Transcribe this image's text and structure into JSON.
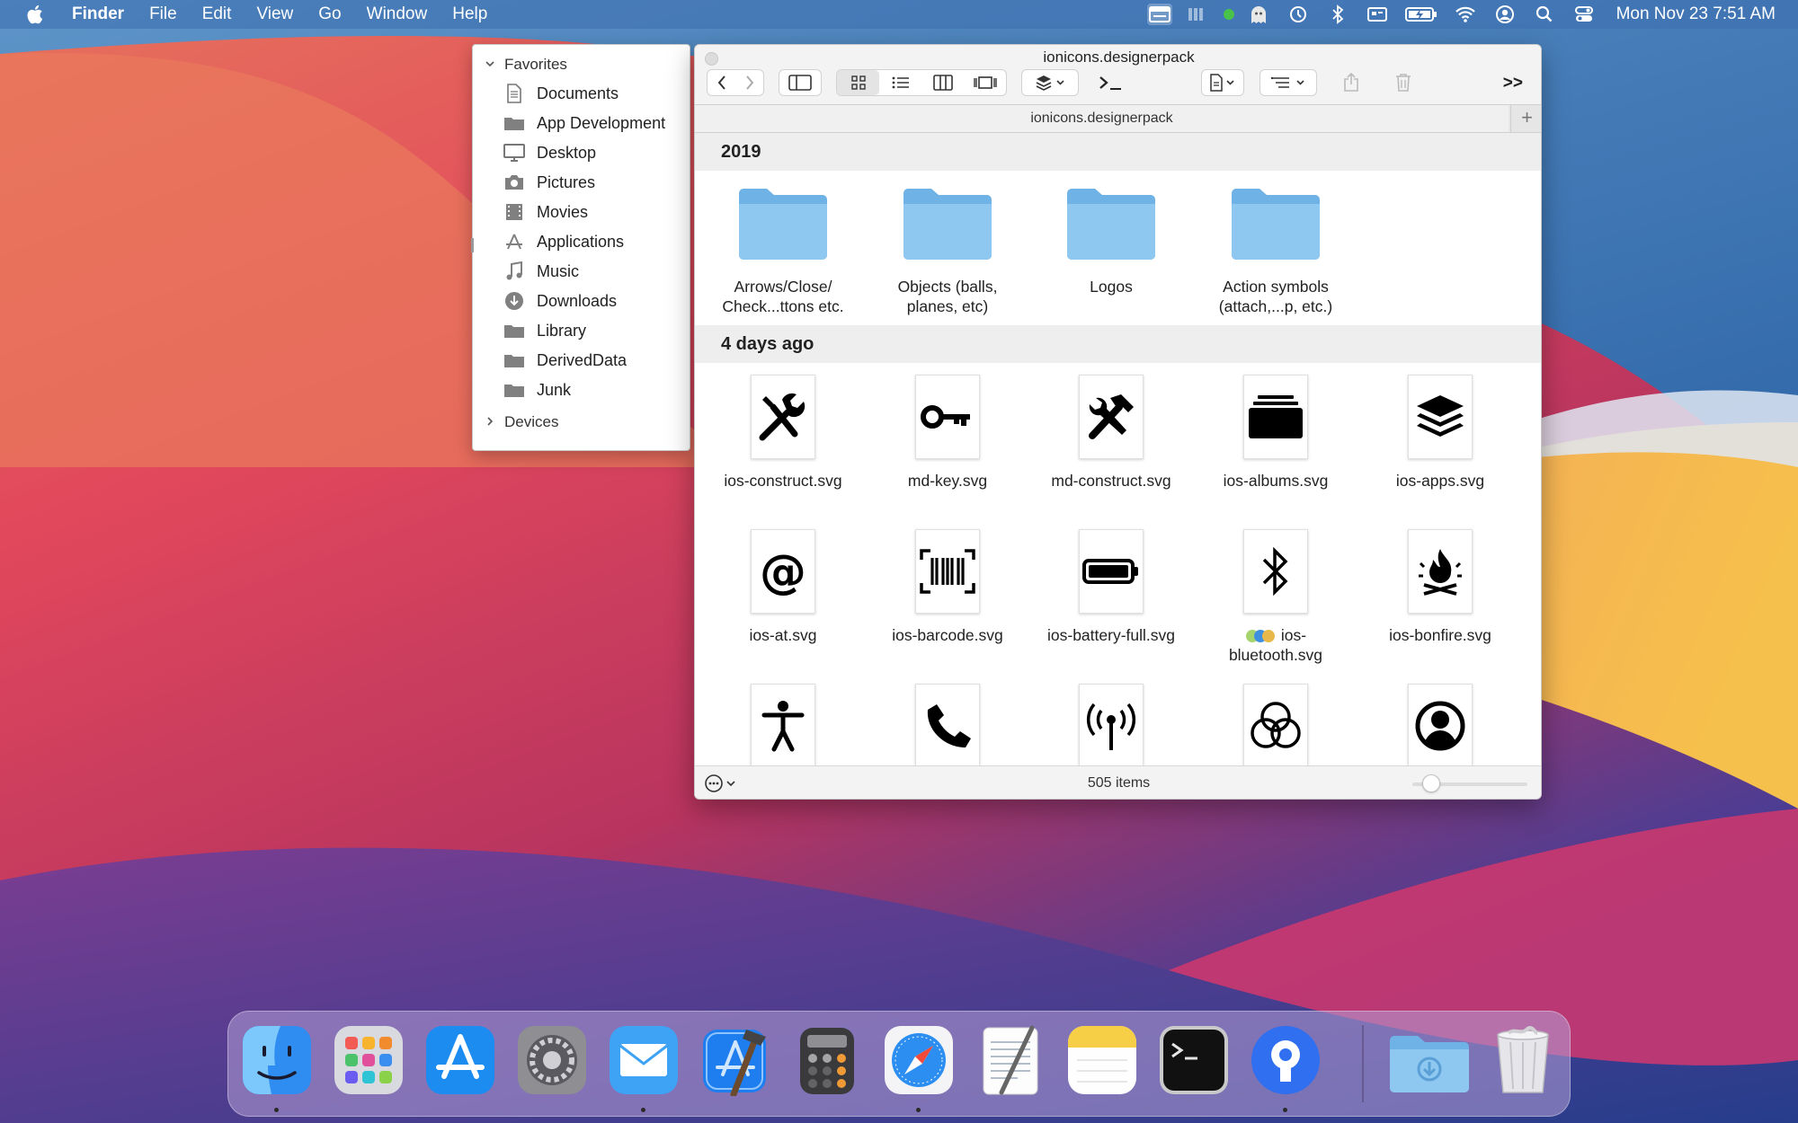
{
  "menubar": {
    "app_name": "Finder",
    "menus": [
      "File",
      "Edit",
      "View",
      "Go",
      "Window",
      "Help"
    ],
    "clock": "Mon Nov 23  7:51 AM",
    "status_icons": [
      "finder-window-icon",
      "battery-bars-icon",
      "green-dot-icon",
      "ghost-icon",
      "time-machine-icon",
      "bluetooth-icon",
      "display-icon",
      "battery-charging-icon",
      "wifi-icon",
      "user-icon",
      "search-icon",
      "control-center-icon"
    ]
  },
  "sidebar": {
    "favorites_label": "Favorites",
    "items": [
      {
        "label": "Documents",
        "icon": "document-icon"
      },
      {
        "label": "App Development",
        "icon": "folder-icon"
      },
      {
        "label": "Desktop",
        "icon": "desktop-icon"
      },
      {
        "label": "Pictures",
        "icon": "camera-icon"
      },
      {
        "label": "Movies",
        "icon": "film-icon"
      },
      {
        "label": "Applications",
        "icon": "applications-icon"
      },
      {
        "label": "Music",
        "icon": "music-icon"
      },
      {
        "label": "Downloads",
        "icon": "download-icon"
      },
      {
        "label": "Library",
        "icon": "folder-icon"
      },
      {
        "label": "DerivedData",
        "icon": "folder-icon"
      },
      {
        "label": "Junk",
        "icon": "folder-icon"
      }
    ],
    "devices_label": "Devices"
  },
  "window": {
    "title": "ionicons.designerpack",
    "tab_title": "ionicons.designerpack",
    "overflow_label": ">>",
    "status_count": "505 items",
    "groups": [
      {
        "header": "2019",
        "items": [
          {
            "label": "Arrows/Close/ Check...ttons etc.",
            "kind": "folder"
          },
          {
            "label": "Objects (balls, planes, etc)",
            "kind": "folder"
          },
          {
            "label": "Logos",
            "kind": "folder"
          },
          {
            "label": "Action symbols (attach,...p, etc.)",
            "kind": "folder"
          }
        ]
      },
      {
        "header": "4 days ago",
        "items": [
          {
            "label": "ios-construct.svg",
            "icon": "construct-icon"
          },
          {
            "label": "md-key.svg",
            "icon": "key-icon"
          },
          {
            "label": "md-construct.svg",
            "icon": "hammer-wrench-icon"
          },
          {
            "label": "ios-albums.svg",
            "icon": "albums-icon"
          },
          {
            "label": "ios-apps.svg",
            "icon": "layers-icon"
          },
          {
            "label": "ios-at.svg",
            "icon": "at-icon"
          },
          {
            "label": "ios-barcode.svg",
            "icon": "barcode-icon"
          },
          {
            "label": "ios-battery-full.svg",
            "icon": "battery-full-icon"
          },
          {
            "label": "ios-bluetooth.svg",
            "icon": "bluetooth-icon",
            "tags": [
              "#a6d46c",
              "#3f8fe0",
              "#e8b94a"
            ]
          },
          {
            "label": "ios-bonfire.svg",
            "icon": "bonfire-icon"
          },
          {
            "label": "",
            "icon": "accessibility-icon"
          },
          {
            "label": "",
            "icon": "phone-icon"
          },
          {
            "label": "",
            "icon": "antenna-icon"
          },
          {
            "label": "",
            "icon": "color-filter-icon"
          },
          {
            "label": "",
            "icon": "contact-icon"
          }
        ]
      }
    ]
  },
  "dock": {
    "apps": [
      "Finder",
      "Launchpad",
      "App Store",
      "System Preferences",
      "Mail",
      "Xcode",
      "Calculator",
      "Safari",
      "TextEdit",
      "Notes",
      "Terminal",
      "Proxyman",
      "Downloads",
      "Trash"
    ]
  }
}
